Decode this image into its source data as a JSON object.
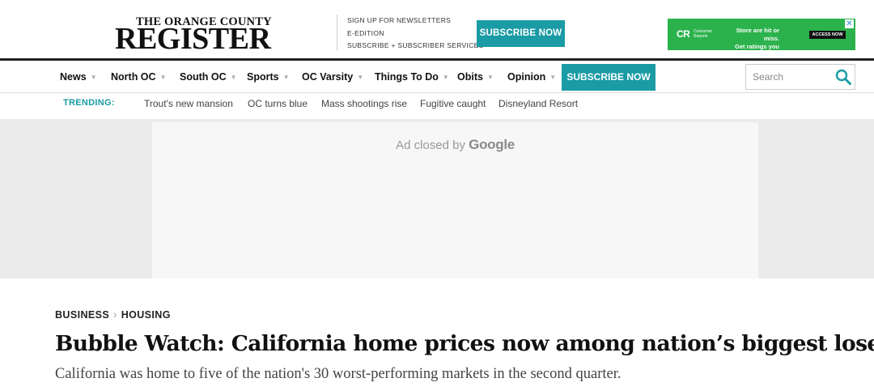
{
  "header": {
    "logo_line1": "THE ORANGE COUNTY",
    "logo_line2": "REGISTER",
    "utility_links": [
      "SIGN UP FOR NEWSLETTERS",
      "E-EDITION",
      "SUBSCRIBE + SUBSCRIBER SERVICES"
    ],
    "subscribe_label": "SUBSCRIBE NOW"
  },
  "ad_banner": {
    "logo": "CR",
    "logo_sub": "Consumer Reports",
    "text_line1": "Store are hit or miss.",
    "text_line2": "Get ratings you can trust.",
    "button": "ACCESS NOW",
    "close": "✕",
    "color": "#2bb24c"
  },
  "nav": {
    "items": [
      {
        "label": "News",
        "caret": true
      },
      {
        "label": "North OC",
        "caret": true
      },
      {
        "label": "South OC",
        "caret": true
      },
      {
        "label": "Sports",
        "caret": true
      },
      {
        "label": "OC Varsity",
        "caret": true
      },
      {
        "label": "Things To Do",
        "caret": true
      },
      {
        "label": "Obits",
        "caret": true
      },
      {
        "label": "Opinion",
        "caret": true
      }
    ],
    "subscribe_label": "SUBSCRIBE NOW",
    "search_placeholder": "Search",
    "accent": "#1a9ba5"
  },
  "trending": {
    "label": "TRENDING:",
    "links": [
      "Trout's new mansion",
      "OC turns blue",
      "Mass shootings rise",
      "Fugitive caught",
      "Disneyland Resort"
    ]
  },
  "ad_area": {
    "closed_text": "Ad closed by",
    "google": "Google"
  },
  "article": {
    "breadcrumb": [
      "BUSINESS",
      "HOUSING"
    ],
    "breadcrumb_sep": "›",
    "headline": "Bubble Watch: California home prices now among nation’s biggest losers",
    "dek": "California was home to five of the nation's 30 worst-performing markets in the second quarter."
  }
}
